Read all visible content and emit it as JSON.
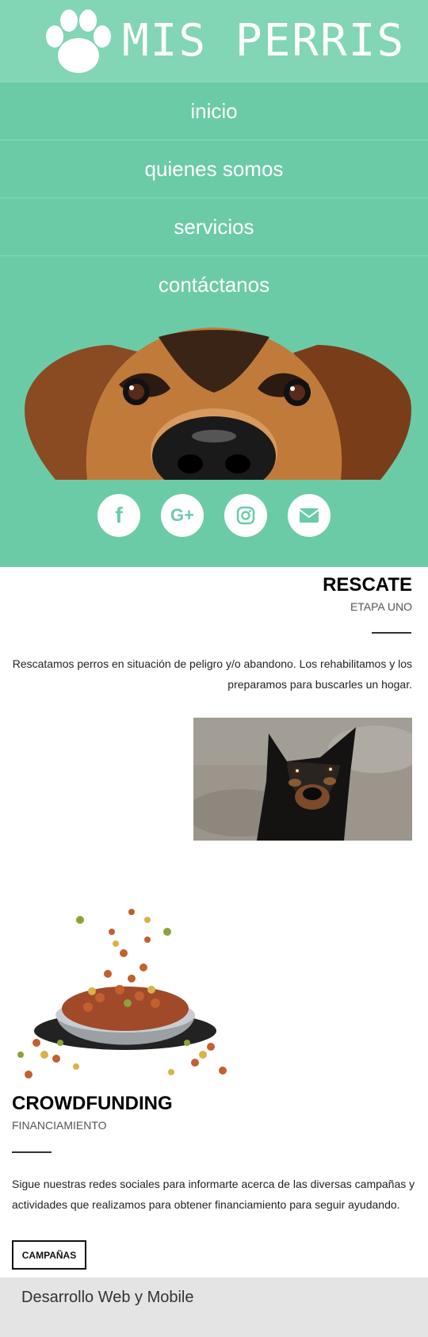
{
  "header": {
    "title": "MIS PERRIS",
    "logo_icon": "paw-icon"
  },
  "nav": {
    "items": [
      {
        "label": "inicio"
      },
      {
        "label": "quienes somos"
      },
      {
        "label": "servicios"
      },
      {
        "label": "contáctanos"
      }
    ]
  },
  "social": [
    {
      "icon": "facebook-icon",
      "glyph": "f"
    },
    {
      "icon": "google-plus-icon",
      "glyph": "G+"
    },
    {
      "icon": "instagram-icon",
      "glyph": ""
    },
    {
      "icon": "email-icon",
      "glyph": ""
    }
  ],
  "rescate": {
    "title": "RESCATE",
    "subtitle": "ETAPA UNO",
    "text_line1": "Rescatamos perros en situación de peligro y/o abandono. Los rehabilitamos y los",
    "text_line2": "preparamos para buscarles un hogar."
  },
  "crowdfunding": {
    "title": "CROWDFUNDING",
    "subtitle": "FINANCIAMIENTO",
    "text_line1": "Sigue nuestras redes sociales para informarte acerca de las diversas campañas y",
    "text_line2": "actividades que realizamos para obtener financiamiento para seguir ayudando.",
    "button_label": "CAMPAÑAS"
  },
  "footer": {
    "text": "Desarrollo Web y Mobile"
  },
  "colors": {
    "header_bg": "#82d5b5",
    "nav_bg": "#6ccba7",
    "footer_bg": "#e4e4e4"
  }
}
